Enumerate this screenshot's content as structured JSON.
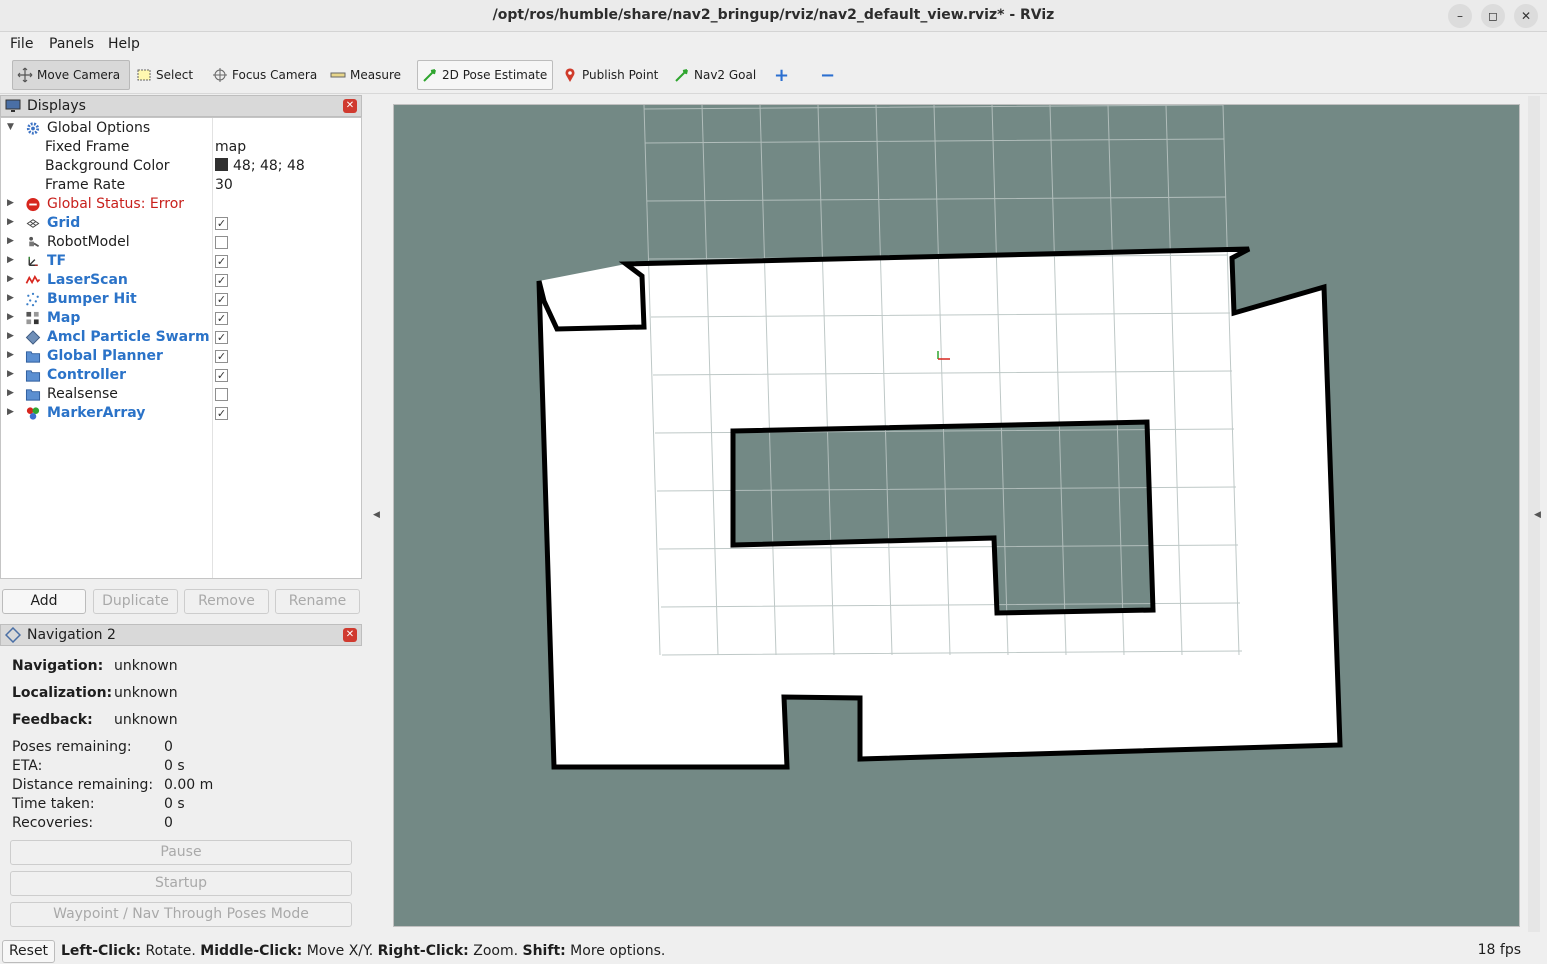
{
  "window": {
    "title": "/opt/ros/humble/share/nav2_bringup/rviz/nav2_default_view.rviz* - RViz",
    "minimize": "–",
    "maximize": "◻",
    "close": "✕"
  },
  "menu": {
    "file": "File",
    "panels": "Panels",
    "help": "Help"
  },
  "toolbar": {
    "move_camera": "Move Camera",
    "select": "Select",
    "focus_camera": "Focus Camera",
    "measure": "Measure",
    "pose_estimate": "2D Pose Estimate",
    "publish_point": "Publish Point",
    "nav2_goal": "Nav2 Goal",
    "add_tool": "+",
    "remove_tool": "−"
  },
  "displays": {
    "title": "Displays",
    "global_options": {
      "label": "Global Options",
      "fixed_frame_label": "Fixed Frame",
      "fixed_frame": "map",
      "background_color_label": "Background Color",
      "background_color": "48; 48; 48",
      "background_color_hex": "#303030",
      "frame_rate_label": "Frame Rate",
      "frame_rate": "30"
    },
    "global_status": "Global Status: Error",
    "items": [
      {
        "label": "Grid",
        "checked": true,
        "highlight": true,
        "icon": "grid-icon"
      },
      {
        "label": "RobotModel",
        "checked": false,
        "highlight": false,
        "icon": "robot-icon"
      },
      {
        "label": "TF",
        "checked": true,
        "highlight": true,
        "icon": "tf-axes-icon"
      },
      {
        "label": "LaserScan",
        "checked": true,
        "highlight": true,
        "icon": "laser-icon"
      },
      {
        "label": "Bumper Hit",
        "checked": true,
        "highlight": true,
        "icon": "points-icon"
      },
      {
        "label": "Map",
        "checked": true,
        "highlight": true,
        "icon": "map-icon"
      },
      {
        "label": "Amcl Particle Swarm",
        "checked": true,
        "highlight": true,
        "icon": "particle-icon"
      },
      {
        "label": "Global Planner",
        "checked": true,
        "highlight": true,
        "icon": "folder-icon"
      },
      {
        "label": "Controller",
        "checked": true,
        "highlight": true,
        "icon": "folder-icon"
      },
      {
        "label": "Realsense",
        "checked": false,
        "highlight": false,
        "icon": "folder-icon"
      },
      {
        "label": "MarkerArray",
        "checked": true,
        "highlight": true,
        "icon": "marker-icon"
      }
    ],
    "buttons": {
      "add": "Add",
      "duplicate": "Duplicate",
      "remove": "Remove",
      "rename": "Rename"
    }
  },
  "navigation": {
    "title": "Navigation 2",
    "navigation_label": "Navigation:",
    "navigation": "unknown",
    "localization_label": "Localization:",
    "localization": "unknown",
    "feedback_label": "Feedback:",
    "feedback": "unknown",
    "poses_remaining_label": "Poses remaining:",
    "poses_remaining": "0",
    "eta_label": "ETA:",
    "eta": "0 s",
    "distance_remaining_label": "Distance remaining:",
    "distance_remaining": "0.00 m",
    "time_taken_label": "Time taken:",
    "time_taken": "0 s",
    "recoveries_label": "Recoveries:",
    "recoveries": "0",
    "pause": "Pause",
    "startup": "Startup",
    "waypoint_mode": "Waypoint / Nav Through Poses Mode"
  },
  "status": {
    "reset": "Reset",
    "left_click": "Left-Click:",
    "left_click_action": " Rotate. ",
    "middle_click": "Middle-Click:",
    "middle_click_action": " Move X/Y. ",
    "right_click": "Right-Click:",
    "right_click_action": " Zoom. ",
    "shift": "Shift:",
    "shift_action": " More options.",
    "fps": "18 fps"
  },
  "colors": {
    "viewport_bg": "#738985",
    "free_space": "#ffffff",
    "obstacle": "#000000",
    "highlight_text": "#2b73c8",
    "error_text": "#c8201c"
  }
}
